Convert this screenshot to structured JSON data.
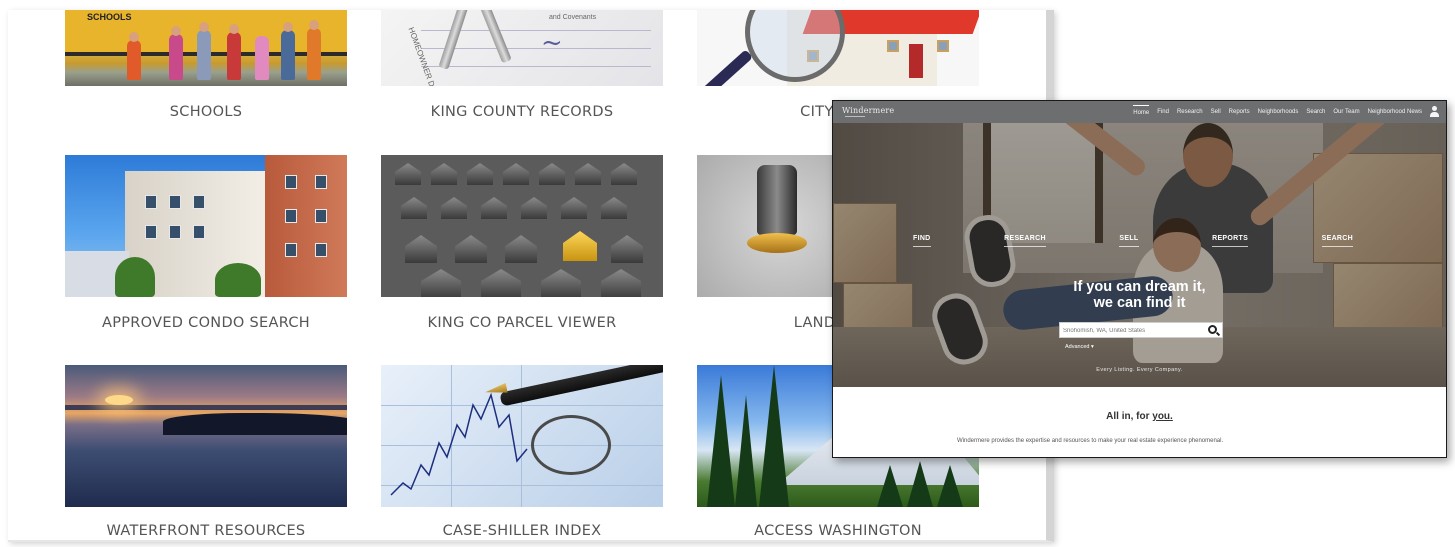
{
  "grid": {
    "tiles": [
      {
        "label": "SCHOOLS",
        "image": "school-bus-children"
      },
      {
        "label": "KING COUNTY RECORDS",
        "image": "keys-on-deed"
      },
      {
        "label": "CITY-DATA",
        "image": "magnifier-house"
      },
      {
        "label": "APPROVED CONDO SEARCH",
        "image": "condo-building"
      },
      {
        "label": "KING CO PARCEL VIEWER",
        "image": "house-grid"
      },
      {
        "label": "LANDLORD-",
        "image": "chess-piece"
      },
      {
        "label": "WATERFRONT RESOURCES",
        "image": "lake-sunset"
      },
      {
        "label": "CASE-SHILLER INDEX",
        "image": "stock-chart-glasses"
      },
      {
        "label": "ACCESS WASHINGTON",
        "image": "mountain-forest"
      }
    ],
    "schools_bus_text": "SCHOOLS",
    "records_doc_text": "HOMEOWNER DECL",
    "records_doc_text2": "and Covenants"
  },
  "windermere": {
    "logo": "Windermere",
    "nav": [
      "Home",
      "Find",
      "Research",
      "Sell",
      "Reports",
      "Neighborhoods",
      "Search",
      "Our Team",
      "Neighborhood News"
    ],
    "hero_tabs": [
      "FIND",
      "RESEARCH",
      "SELL",
      "REPORTS",
      "SEARCH"
    ],
    "hero_title_line1": "If you can dream it,",
    "hero_title_line2": "we can find it",
    "search_placeholder": "Snohomish, WA, United States",
    "advanced_link": "Advanced ▾",
    "tagline": "Every Listing. Every Company.",
    "section_title_pre": "All in, for ",
    "section_title_emph": "you.",
    "section_text": "Windermere provides the expertise and resources to make your real estate experience phenomenal."
  },
  "colors": {
    "nav_bg": "#6d6e70",
    "label_text": "#555555",
    "roof_red": "#e0382a",
    "gold_house": "#ffd65a"
  }
}
